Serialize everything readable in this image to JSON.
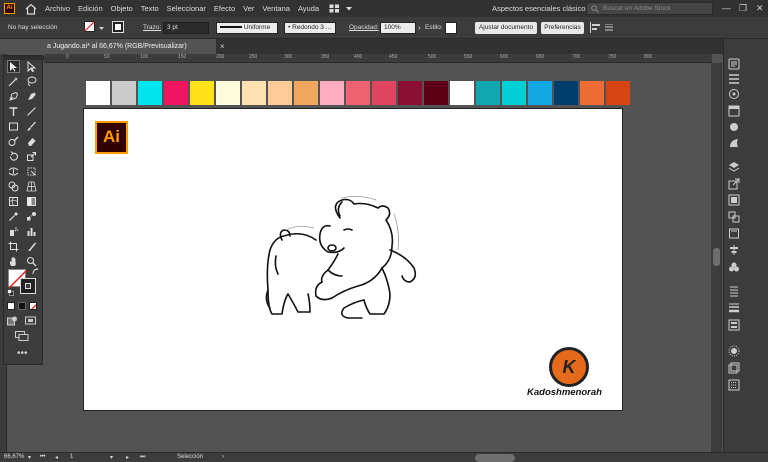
{
  "menubar": {
    "app_icon": "Ai",
    "items": [
      "Archivo",
      "Edición",
      "Objeto",
      "Texto",
      "Seleccionar",
      "Efecto",
      "Ver",
      "Ventana",
      "Ayuda"
    ],
    "workspace": "Aspectos esenciales clásicos",
    "stock_search_placeholder": "Buscar en Adobe Stock"
  },
  "control_bar": {
    "selection_status": "No hay selección",
    "stroke_label": "Trazo:",
    "stroke_value": "3 pt",
    "stroke_profile": "Uniforme",
    "brush": "Redondo 3 ...",
    "opacity_label": "Opacidad:",
    "opacity_value": "100%",
    "style_label": "Estilo:",
    "align_button": "Ajustar documento",
    "prefs_button": "Preferencias"
  },
  "document": {
    "tab_title": "a Jugando.ai* al 66,67% (RGB/Previsualizar)",
    "tab_close": "×"
  },
  "ruler": {
    "ticks": [
      "0",
      "50",
      "100",
      "150",
      "200",
      "250",
      "300",
      "350",
      "400",
      "450",
      "500",
      "550",
      "600",
      "650",
      "700",
      "750",
      "800"
    ]
  },
  "swatches": [
    "#ffffff",
    "#cccccc",
    "#00e5ee",
    "#ef1560",
    "#ffe21a",
    "#fffbdb",
    "#ffe1b2",
    "#ffcc99",
    "#f2a75e",
    "#ffabc0",
    "#ee6272",
    "#e0455f",
    "#8a0f33",
    "#5e0016",
    "#ffffff",
    "#10a7b0",
    "#00d0d6",
    "#12a7e3",
    "#003e6c",
    "#ef6c34",
    "#d64513"
  ],
  "artwork": {
    "ai_badge": "Ai",
    "k_letter": "K",
    "k_name": "Kadoshmenorah"
  },
  "status": {
    "zoom": "66,67%",
    "artboard_number": "1",
    "tool_name": "Selección"
  },
  "colors": {
    "ui_dark": "#323232",
    "ui_panel": "#3c3c3c",
    "canvas": "#535353",
    "accent_orange": "#ff9a00"
  }
}
